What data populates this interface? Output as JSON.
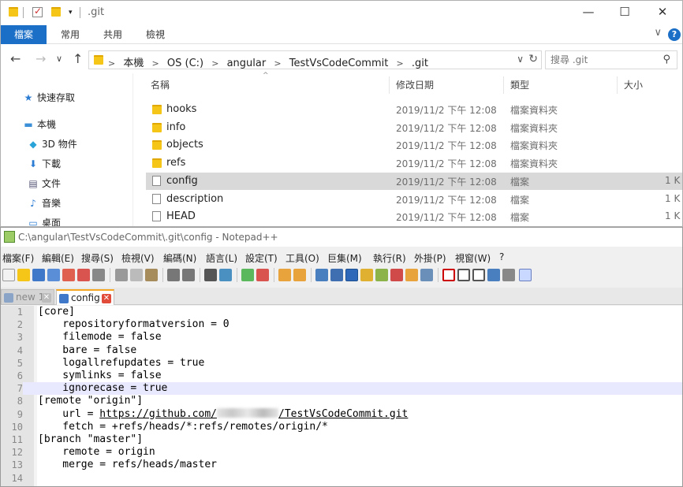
{
  "explorer": {
    "title": ".git",
    "window_controls": {
      "minimize": "—",
      "maximize": "☐",
      "close": "✕"
    },
    "ribbon_tabs": [
      "檔案",
      "常用",
      "共用",
      "檢視"
    ],
    "ribbon_chevron": "∨",
    "help": "?",
    "nav": {
      "back": "←",
      "forward": "→",
      "recent": "∨",
      "up": "↑"
    },
    "breadcrumbs": [
      "本機",
      "OS (C:)",
      "angular",
      "TestVsCodeCommit",
      ".git"
    ],
    "address_dropdown": "∨",
    "refresh": "↻",
    "search_placeholder": "搜尋 .git",
    "nav_pane": [
      {
        "label": "快速存取",
        "icon": "star-icon",
        "glyph": "★"
      },
      {
        "label": "本機",
        "icon": "computer-icon",
        "glyph": "▬"
      },
      {
        "label": "3D 物件",
        "icon": "cube-icon",
        "glyph": "◆"
      },
      {
        "label": "下載",
        "icon": "download-icon",
        "glyph": "⬇"
      },
      {
        "label": "文件",
        "icon": "document-icon",
        "glyph": "▤"
      },
      {
        "label": "音樂",
        "icon": "music-icon",
        "glyph": "♪"
      },
      {
        "label": "桌面",
        "icon": "desktop-icon",
        "glyph": "▭"
      }
    ],
    "columns": {
      "name": "名稱",
      "date": "修改日期",
      "type": "類型",
      "size": "大小",
      "sort_indicator": "^"
    },
    "files": [
      {
        "name": "hooks",
        "date": "2019/11/2 下午 12:08",
        "type": "檔案資料夾",
        "size": "",
        "kind": "folder"
      },
      {
        "name": "info",
        "date": "2019/11/2 下午 12:08",
        "type": "檔案資料夾",
        "size": "",
        "kind": "folder"
      },
      {
        "name": "objects",
        "date": "2019/11/2 下午 12:08",
        "type": "檔案資料夾",
        "size": "",
        "kind": "folder"
      },
      {
        "name": "refs",
        "date": "2019/11/2 下午 12:08",
        "type": "檔案資料夾",
        "size": "",
        "kind": "folder"
      },
      {
        "name": "config",
        "date": "2019/11/2 下午 12:08",
        "type": "檔案",
        "size": "1 K",
        "kind": "file",
        "selected": true
      },
      {
        "name": "description",
        "date": "2019/11/2 下午 12:08",
        "type": "檔案",
        "size": "1 K",
        "kind": "file"
      },
      {
        "name": "HEAD",
        "date": "2019/11/2 下午 12:08",
        "type": "檔案",
        "size": "1 K",
        "kind": "file"
      }
    ]
  },
  "notepad": {
    "title": "C:\\angular\\TestVsCodeCommit\\.git\\config - Notepad++",
    "menu": [
      "檔案(F)",
      "編輯(E)",
      "搜尋(S)",
      "檢視(V)",
      "編碼(N)",
      "語言(L)",
      "設定(T)",
      "工具(O)",
      "巨集(M)",
      "執行(R)",
      "外掛(P)",
      "視窗(W)",
      "?"
    ],
    "tabs": [
      {
        "label": "new 1",
        "close": "✕",
        "active": false
      },
      {
        "label": "config",
        "close": "✕",
        "active": true
      }
    ],
    "lines": [
      "[core]",
      "    repositoryformatversion = 0",
      "    filemode = false",
      "    bare = false",
      "    logallrefupdates = true",
      "    symlinks = false",
      "    ignorecase = true",
      "[remote \"origin\"]",
      "",
      "    fetch = +refs/heads/*:refs/remotes/origin/*",
      "[branch \"master\"]",
      "    remote = origin",
      "    merge = refs/heads/master",
      ""
    ],
    "url_line": {
      "prefix": "    url = ",
      "host": "https://github.com/",
      "repo": "/TestVsCodeCommit.git"
    },
    "current_line": 7
  }
}
